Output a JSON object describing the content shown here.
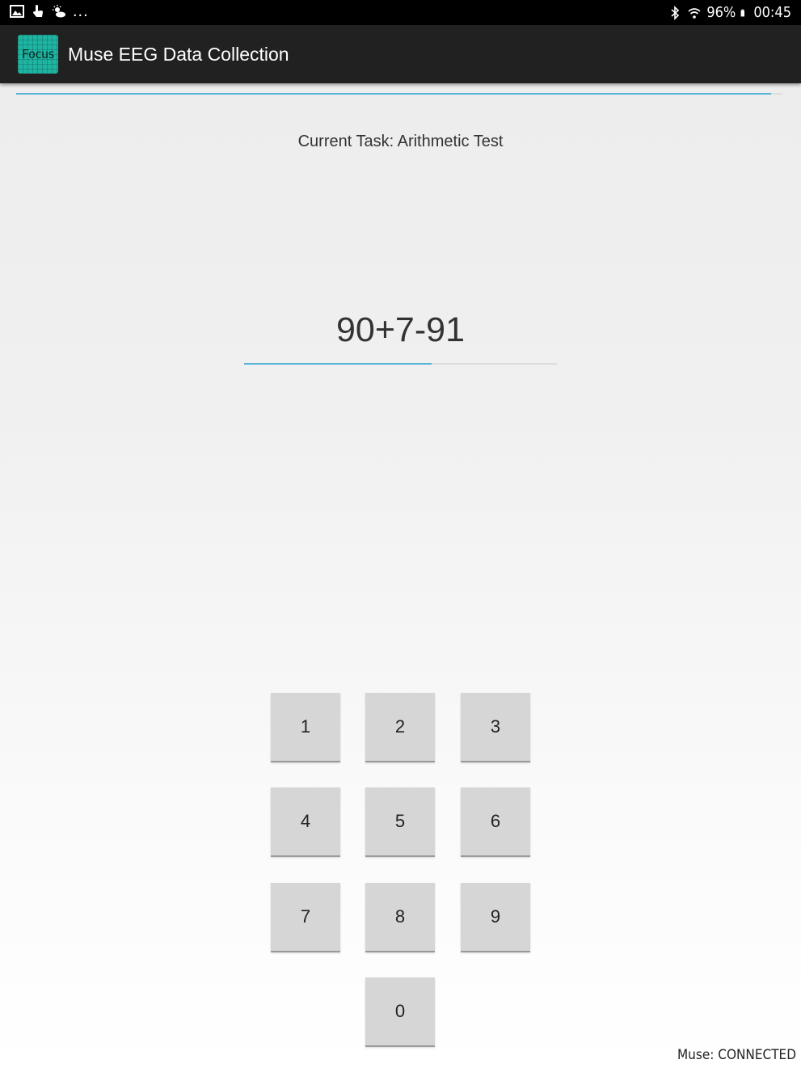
{
  "status_bar": {
    "left_icons": [
      "gallery-icon",
      "touch-icon",
      "weather-icon"
    ],
    "more": "...",
    "battery_percent": "96%",
    "time": "00:45"
  },
  "app_bar": {
    "logo_text": "Focus",
    "title": "Muse EEG Data Collection"
  },
  "progress": {
    "task_progress": 0.985,
    "answer_progress": 0.6
  },
  "task": {
    "label": "Current Task: Arithmetic Test"
  },
  "question": {
    "equation": "90+7-91"
  },
  "keypad": {
    "k1": "1",
    "k2": "2",
    "k3": "3",
    "k4": "4",
    "k5": "5",
    "k6": "6",
    "k7": "7",
    "k8": "8",
    "k9": "9",
    "k0": "0"
  },
  "footer": {
    "muse_status": "Muse: CONNECTED"
  },
  "colors": {
    "accent": "#5ab4d8",
    "app_bar": "#212121",
    "logo": "#1fb4a2",
    "key": "#d6d6d6"
  }
}
